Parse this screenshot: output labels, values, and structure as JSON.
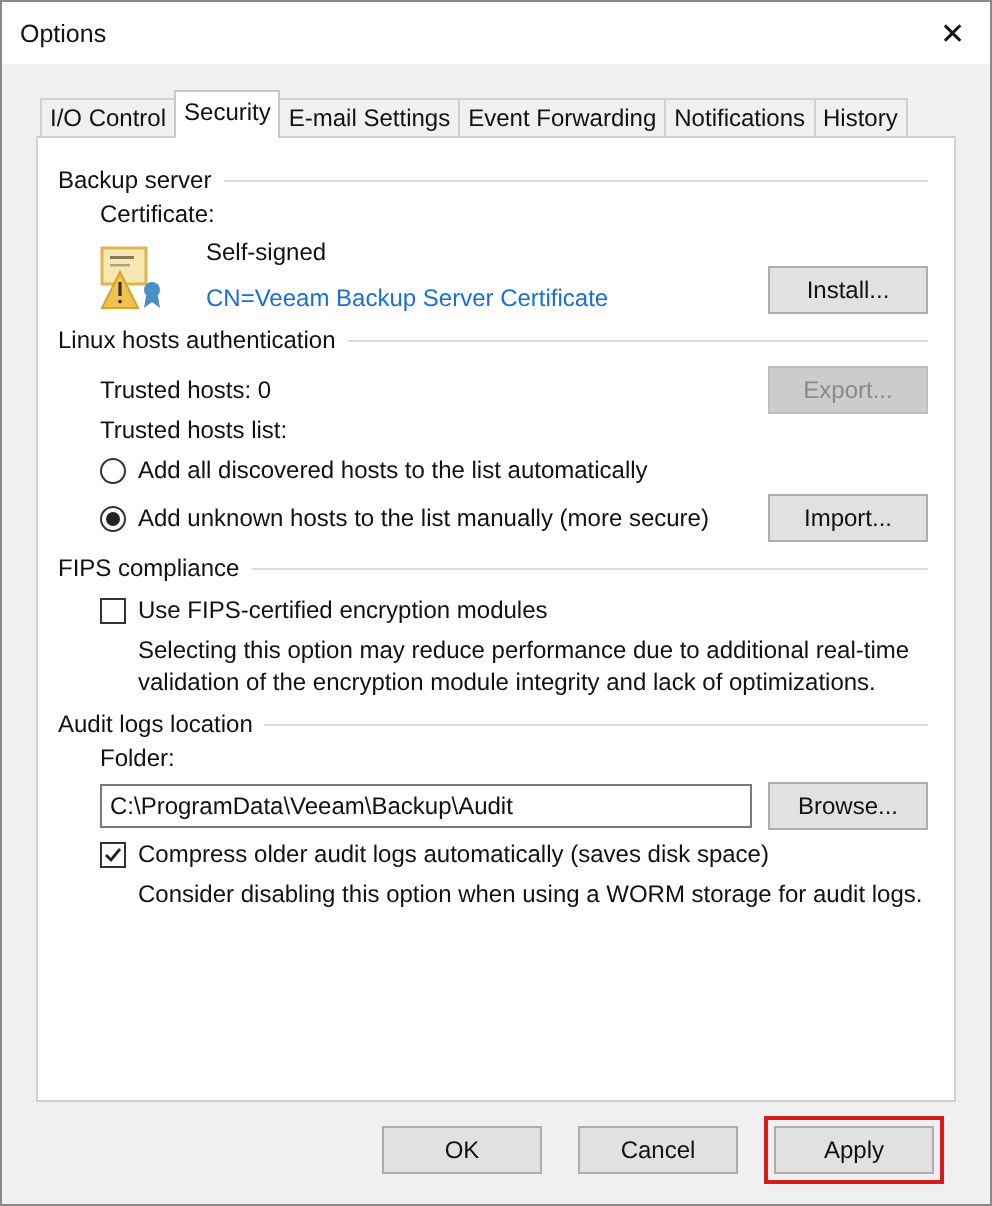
{
  "window": {
    "title": "Options",
    "close": "✕"
  },
  "tabs": [
    {
      "label": "I/O Control",
      "selected": false
    },
    {
      "label": "Security",
      "selected": true
    },
    {
      "label": "E-mail Settings",
      "selected": false
    },
    {
      "label": "Event Forwarding",
      "selected": false
    },
    {
      "label": "Notifications",
      "selected": false
    },
    {
      "label": "History",
      "selected": false
    }
  ],
  "backup_server": {
    "heading": "Backup server",
    "certificate_label": "Certificate:",
    "certificate_type": "Self-signed",
    "certificate_name": "CN=Veeam Backup Server Certificate",
    "install_button": {
      "label": "Install...",
      "disabled": false
    }
  },
  "linux_hosts": {
    "heading": "Linux hosts authentication",
    "trusted_hosts": "Trusted hosts: 0",
    "export_button": {
      "label": "Export...",
      "disabled": true
    },
    "list_label": "Trusted hosts list:",
    "options": [
      {
        "label": "Add all discovered hosts to the list automatically",
        "selected": false
      },
      {
        "label": "Add unknown hosts to the list manually (more secure)",
        "selected": true
      }
    ],
    "import_button": {
      "label": "Import...",
      "disabled": false
    }
  },
  "fips": {
    "heading": "FIPS compliance",
    "checkbox": {
      "label": "Use FIPS-certified encryption modules",
      "checked": false
    },
    "note": "Selecting this option may reduce performance due to additional real-time validation of the encryption module integrity and lack of optimizations."
  },
  "audit_logs": {
    "heading": "Audit logs location",
    "folder_label": "Folder:",
    "folder_value": "C:\\ProgramData\\Veeam\\Backup\\Audit",
    "browse_button": {
      "label": "Browse...",
      "disabled": false
    },
    "checkbox": {
      "label": "Compress older audit logs automatically (saves disk space)",
      "checked": true
    },
    "note": "Consider disabling this option when using a WORM storage for audit logs."
  },
  "buttons": [
    {
      "label": "OK",
      "highlighted": false
    },
    {
      "label": "Cancel",
      "highlighted": false
    },
    {
      "label": "Apply",
      "highlighted": true
    }
  ]
}
